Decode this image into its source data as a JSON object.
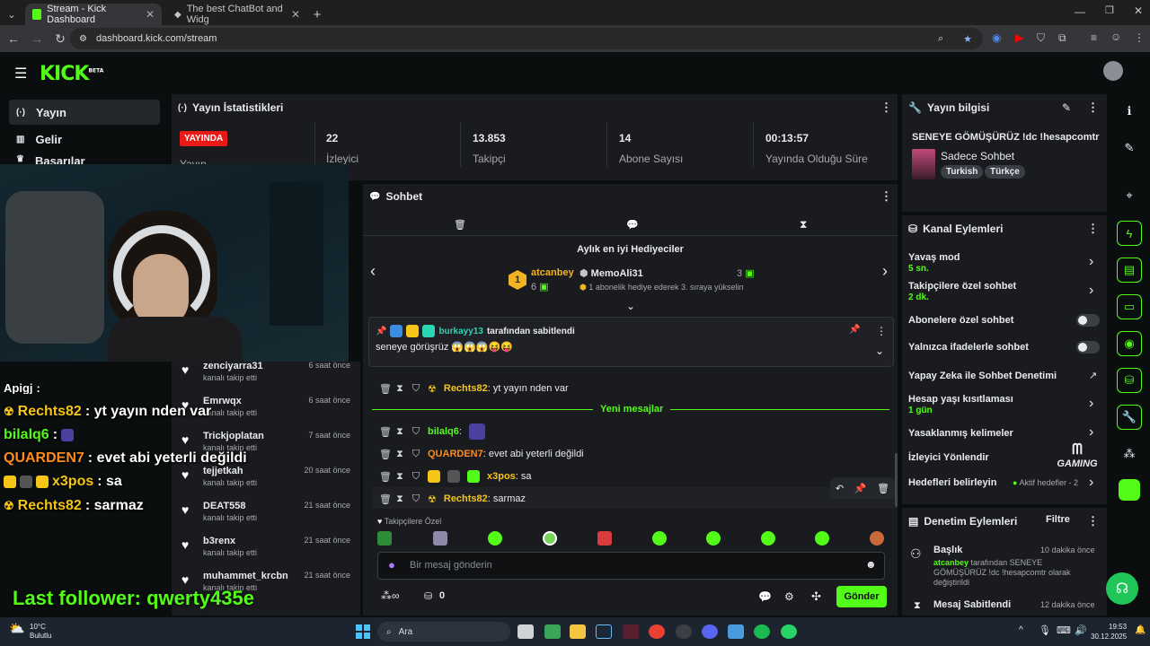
{
  "browser": {
    "tabs": [
      {
        "label": "Stream - Kick Dashboard",
        "active": true
      },
      {
        "label": "The best ChatBot and Widg",
        "active": false
      }
    ],
    "url": "dashboard.kick.com/stream"
  },
  "kick": {
    "logo": "KICK",
    "logo_sup": "BETA"
  },
  "sidebar": {
    "items": [
      {
        "label": "Yayın",
        "icon": "broadcast-icon",
        "active": true
      },
      {
        "label": "Gelir",
        "icon": "chart-icon",
        "active": false
      },
      {
        "label": "Başarılar",
        "icon": "trophy-icon",
        "active": false
      }
    ]
  },
  "stats": {
    "title": "Yayın İstatistikleri",
    "live_badge": "YAYINDA",
    "live_label": "Yayın",
    "items": [
      {
        "value": "22",
        "label": "İzleyici"
      },
      {
        "value": "13.853",
        "label": "Takipçi"
      },
      {
        "value": "14",
        "label": "Abone Sayısı"
      },
      {
        "value": "00:13:57",
        "label": "Yayında Olduğu Süre"
      }
    ]
  },
  "chat": {
    "title": "Sohbet",
    "gifters_title": "Aylık en iyi Hediyeciler",
    "gifter1_name": "atcanbey",
    "gifter1_count": "6",
    "gifter1_rank": "1",
    "gifter2_name": "MemoAli31",
    "gifter2_count": "3",
    "gifter2_note": "1 abonelik hediye ederek 3. sıraya yükselin",
    "pinned_by": "burkayy13",
    "pinned_suffix": "tarafından sabitlendi",
    "pinned_msg": "seneye görüşrüz 😱😱😱😝😝",
    "new_messages": "Yeni mesajlar",
    "messages": [
      {
        "user": "Rechts82",
        "text": ": yt yayın nden var",
        "color": "#f5c518"
      },
      {
        "user": "bilalq6",
        "text": ":",
        "color": "#53fc18"
      },
      {
        "user": "QUARDEN7",
        "text": ": evet abi yeterli değildi",
        "color": "#ff8c1a"
      },
      {
        "user": "x3pos",
        "text": ": sa",
        "color": "#f5c518"
      },
      {
        "user": "Rechts82",
        "text": ": sarmaz",
        "color": "#f5c518"
      }
    ],
    "followers_only": "Takipçilere Özel",
    "input_placeholder": "Bir mesaj gönderin",
    "points": "0",
    "send_label": "Gönder"
  },
  "stream_info": {
    "title": "Yayın bilgisi",
    "stream_title": "SENEYE GÖMÜŞÜRÜZ !dc !hesapcomtr",
    "category": "Sadece Sohbet",
    "tags": [
      "Turkish",
      "Türkçe"
    ]
  },
  "channel_actions": {
    "title": "Kanal Eylemleri",
    "slow_mode": "Yavaş mod",
    "slow_mode_value": "5 sn.",
    "followers_chat": "Takipçilere özel sohbet",
    "followers_chat_value": "2 dk.",
    "subs_chat": "Abonelere özel sohbet",
    "emote_chat": "Yalnızca ifadelerle sohbet",
    "ai_moderation": "Yapay Zeka ile Sohbet Denetimi",
    "age_restriction": "Hesap yaşı kısıtlaması",
    "age_restriction_value": "1 gün",
    "banned_words": "Yasaklanmış kelimeler",
    "viewer_redirect": "İzleyici Yönlendir",
    "goals": "Hedefleri belirleyin",
    "goals_value": "Aktif hedefler - 2"
  },
  "mod_actions": {
    "title": "Denetim Eylemleri",
    "filter": "Filtre",
    "item1_title": "Başlık",
    "item1_time": "10 dakika önce",
    "item1_user": "atcanbey",
    "item1_text": "tarafından SENEYE GÖMÜŞÜRÜZ !dc !hesapcomtr olarak değiştirildi",
    "item2_title": "Mesaj Sabitlendi",
    "item2_time": "12 dakika önce"
  },
  "overlay": {
    "chat_lines": [
      {
        "user": "Apigj",
        "text": ":",
        "color": "#ffffff"
      },
      {
        "user": "Rechts82",
        "text": ": yt yayın nden var",
        "color": "#f5c518"
      },
      {
        "user": "bilalq6",
        "text": ":",
        "color": "#53fc18"
      },
      {
        "user": "QUARDEN7",
        "text": ": evet abi yeterli değildi",
        "color": "#ff8c1a"
      },
      {
        "user": "x3pos",
        "text": ": sa",
        "color": "#f5c518"
      },
      {
        "user": "Rechts82",
        "text": ": sarmaz",
        "color": "#f5c518"
      }
    ],
    "last_follower": "Last follower: qwerty435e",
    "watermark": "GAMING",
    "followers": [
      {
        "name": "zenciyarra31",
        "sub": "kanalı takip etti",
        "time": "6 saat önce"
      },
      {
        "name": "Emrwqx",
        "sub": "kanalı takip etti",
        "time": "6 saat önce"
      },
      {
        "name": "Trickjoplatan",
        "sub": "kanalı takip etti",
        "time": "7 saat önce"
      },
      {
        "name": "tejjetkah",
        "sub": "kanalı takip etti",
        "time": "20 saat önce"
      },
      {
        "name": "DEAT558",
        "sub": "kanalı takip etti",
        "time": "21 saat önce"
      },
      {
        "name": "b3renx",
        "sub": "kanalı takip etti",
        "time": "21 saat önce"
      },
      {
        "name": "muhammet_krcbn",
        "sub": "kanalı takip etti",
        "time": "21 saat önce"
      }
    ]
  },
  "taskbar": {
    "weather_temp": "10°C",
    "weather_desc": "Bulutlu",
    "search": "Ara",
    "time": "19:53",
    "date": "30.12.2025"
  },
  "colors": {
    "kick_green": "#53fc18",
    "live_red": "#e91916",
    "panel": "#191b1f"
  }
}
